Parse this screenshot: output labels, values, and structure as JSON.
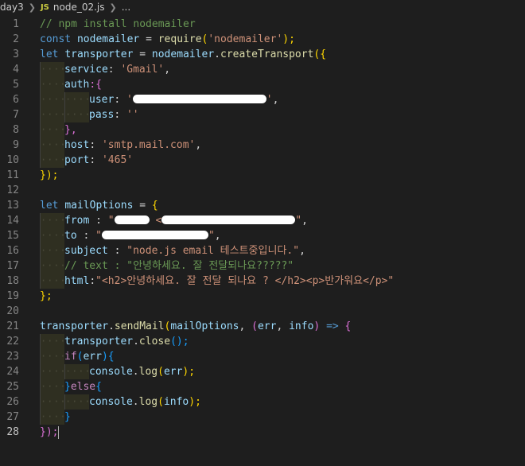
{
  "breadcrumb": {
    "folder": "day3",
    "file": "node_02.js",
    "badge": "JS",
    "tail": "..."
  },
  "code": {
    "l1": "// npm install nodemailer",
    "l2": [
      "const",
      "nodemailer",
      "=",
      "require",
      "(",
      "'nodemailer'",
      ");"
    ],
    "l3": [
      "let",
      "transporter",
      "=",
      "nodemailer",
      ".",
      "createTransport",
      "({"
    ],
    "l4": [
      "service",
      ": ",
      "'Gmail'",
      ","
    ],
    "l5": [
      "auth",
      ":{"
    ],
    "l6": [
      "user",
      ": ",
      "'",
      "'",
      ","
    ],
    "l7": [
      "pass",
      ": ",
      "''"
    ],
    "l8": "},",
    "l9": [
      "host",
      ": ",
      "'smtp.mail.com'",
      ","
    ],
    "l10": [
      "port",
      ": ",
      "'465'"
    ],
    "l11": "});",
    "l13": [
      "let",
      "mailOptions",
      "=",
      "{"
    ],
    "l14": [
      "from",
      " : ",
      "\"",
      "<",
      "\"",
      ","
    ],
    "l15": [
      "to",
      " : ",
      "\"",
      "\"",
      ","
    ],
    "l16": [
      "subject",
      " : ",
      "\"node.js email 테스트중입니다.\"",
      ","
    ],
    "l17": "// text : \"안녕하세요. 잘 전달되나요?????\"",
    "l18": [
      "html",
      ":",
      "\"<h2>안녕하세요. 잘 전달 되나요 ? </h2><p>반가워요</p>\""
    ],
    "l19": "};",
    "l21": [
      "transporter",
      ".",
      "sendMail",
      "(",
      "mailOptions",
      ", ",
      "(",
      "err",
      ", ",
      "info",
      ") ",
      "=>",
      " {"
    ],
    "l22": [
      "transporter",
      ".",
      "close",
      "();"
    ],
    "l23": [
      "if",
      "(",
      "err",
      "){"
    ],
    "l24": [
      "console",
      ".",
      "log",
      "(",
      "err",
      ");"
    ],
    "l25": [
      "}",
      "else",
      "{"
    ],
    "l26": [
      "console",
      ".",
      "log",
      "(",
      "info",
      ");"
    ],
    "l27": "}",
    "l28": "});"
  },
  "line_numbers": [
    "1",
    "2",
    "3",
    "4",
    "5",
    "6",
    "7",
    "8",
    "9",
    "10",
    "11",
    "12",
    "13",
    "14",
    "15",
    "16",
    "17",
    "18",
    "19",
    "20",
    "21",
    "22",
    "23",
    "24",
    "25",
    "26",
    "27",
    "28"
  ]
}
